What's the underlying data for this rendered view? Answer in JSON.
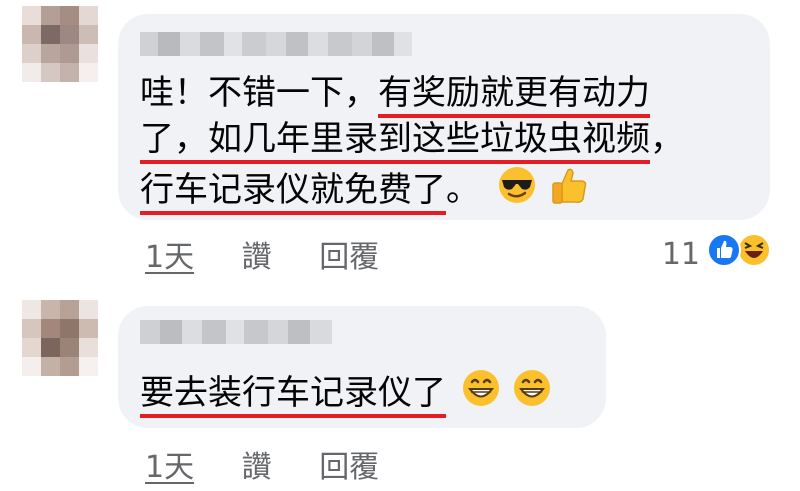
{
  "comments": [
    {
      "author_name": "",
      "text_lines": [
        {
          "plain": "哇！不错一下，",
          "underlined": "有奖励就更有动力"
        },
        {
          "plain": "",
          "underlined": "了，如几年里录到这些垃圾虫视频",
          "trailing": "，"
        },
        {
          "plain": "",
          "underlined": "行车记录仪就免费了",
          "trailing": "。"
        }
      ],
      "emojis": [
        "cool-face-emoji",
        "thumbs-up-emoji"
      ],
      "actions": {
        "time": "1天",
        "like": "讚",
        "reply": "回覆"
      },
      "reaction_count": "11",
      "reaction_icons": [
        "like-reaction-icon",
        "haha-reaction-icon"
      ]
    },
    {
      "author_name": "",
      "text_lines": [
        {
          "plain": "",
          "underlined": "要去装行车记录仪了"
        }
      ],
      "emojis": [
        "grinning-face-emoji",
        "grinning-face-emoji"
      ],
      "actions": {
        "time": "1天",
        "like": "讚",
        "reply": "回覆"
      }
    }
  ],
  "colors": {
    "bubble": "#f0f2f5",
    "underline": "#e41c23",
    "text": "#050505",
    "meta": "#65676b",
    "like_blue": "#1877f2",
    "emoji_yellow": "#fbc12d"
  }
}
